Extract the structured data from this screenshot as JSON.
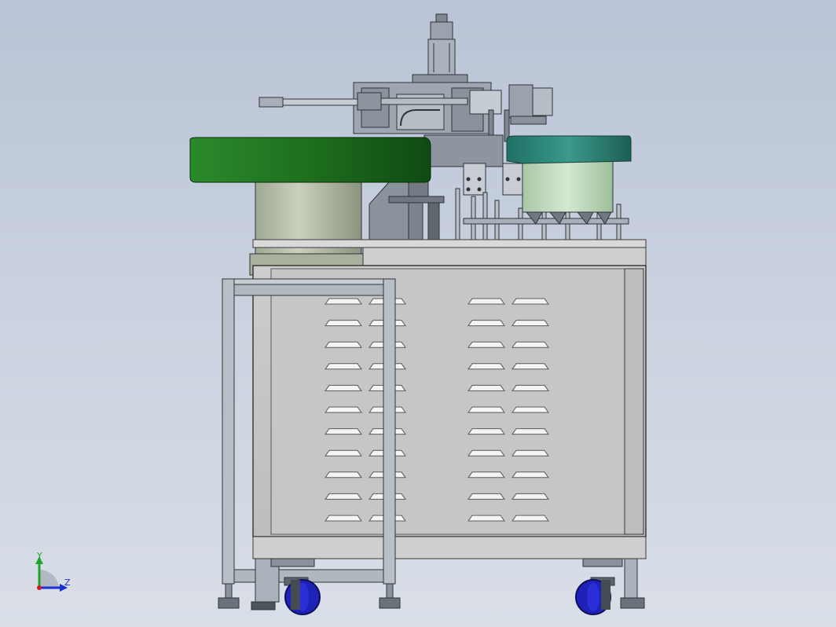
{
  "triad": {
    "y_label": "Y",
    "z_label": "Z",
    "y_color": "#1fa32a",
    "z_color": "#1b2fd6",
    "origin_color": "#d01c1c"
  },
  "colors": {
    "background_top": "#b9c4d6",
    "background_bottom": "#d9dee7",
    "left_bowl": "#1f7a1f",
    "right_bowl": "#2f8a7c",
    "cabinet": "#c4c4c4",
    "frame": "#9aa0a8",
    "wheels": "#1f22b8"
  },
  "vent_slots": {
    "rows": 11,
    "columns": 4
  }
}
